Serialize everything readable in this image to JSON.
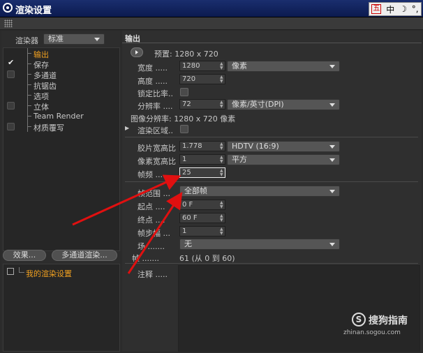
{
  "window": {
    "title": "渲染设置"
  },
  "ime": {
    "guo": "五",
    "zhong": "中",
    "moon": "☽",
    "dot": "°,"
  },
  "left": {
    "renderer_label": "渲染器",
    "renderer_value": "标准",
    "tree": [
      {
        "label": "输出",
        "checked": false,
        "selected": true
      },
      {
        "label": "保存",
        "checked": true,
        "selected": false
      },
      {
        "label": "多通道",
        "checked": false,
        "selected": false
      },
      {
        "label": "抗锯齿",
        "checked": false,
        "selected": false
      },
      {
        "label": "选项",
        "checked": false,
        "selected": false
      },
      {
        "label": "立体",
        "checked": false,
        "selected": false
      },
      {
        "label": "Team Render",
        "checked": false,
        "selected": false
      },
      {
        "label": "材质覆写",
        "checked": false,
        "selected": false
      }
    ],
    "effects_button": "效果...",
    "multipass_button": "多通道渲染...",
    "my_settings": "我的渲染设置"
  },
  "output": {
    "section_title": "输出",
    "preset_label": "预置: 1280 x 720",
    "width_label": "宽度 .....",
    "width_value": "1280",
    "unit_value": "像素",
    "height_label": "高度 .....",
    "height_value": "720",
    "lock_ratio_label": "锁定比率..",
    "resolution_label": "分辨率 ....",
    "resolution_value": "72",
    "resolution_unit": "像素/英寸(DPI)",
    "image_resolution": "图像分辨率: 1280 x 720 像素",
    "render_region_label": "渲染区域..",
    "film_aspect_label": "胶片宽高比",
    "film_aspect_value": "1.778",
    "film_aspect_preset": "HDTV (16:9)",
    "pixel_aspect_label": "像素宽高比",
    "pixel_aspect_value": "1",
    "pixel_aspect_preset": "平方",
    "fps_label": "帧频 .....",
    "fps_value": "25",
    "frame_range_label": "帧范围 ...",
    "frame_range_value": "全部帧",
    "start_label": "起点 ....",
    "start_value": "0 F",
    "end_label": "终点 ....",
    "end_value": "60 F",
    "frame_step_label": "帧步幅 ...",
    "frame_step_value": "1",
    "field_label": "场 .......",
    "field_value": "无",
    "frames_label": "帧 .......",
    "frames_value": "61 (从 0 到 60)",
    "notes_label": "注释 ....."
  },
  "watermark": {
    "logo": "S",
    "text": "搜狗指南",
    "url": "zhinan.sogou.com"
  },
  "colors": {
    "title_bar": "#0b1a4f",
    "selected_item": "#f0a020",
    "annotation_arrow": "#e01010"
  }
}
